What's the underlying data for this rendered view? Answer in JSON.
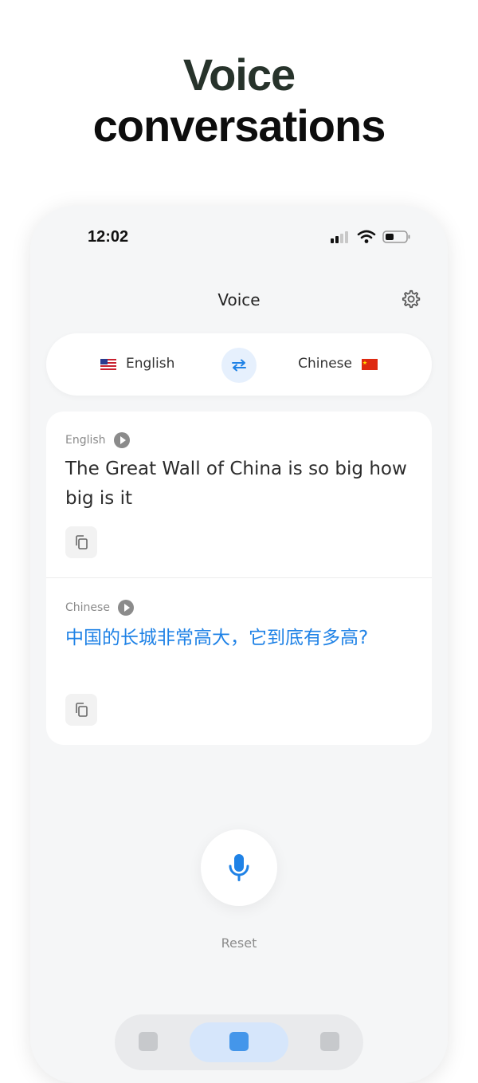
{
  "headline": {
    "line1": "Voice",
    "line2": "conversations"
  },
  "status_bar": {
    "time": "12:02"
  },
  "nav": {
    "title": "Voice",
    "settings_icon": "gear-icon"
  },
  "languages": {
    "source": {
      "label": "English",
      "flag": "us-flag"
    },
    "target": {
      "label": "Chinese",
      "flag": "china-flag"
    },
    "swap_icon": "swap-arrows-icon"
  },
  "translation": {
    "source": {
      "label": "English",
      "text": "The Great Wall of China is so big how big is it"
    },
    "target": {
      "label": "Chinese",
      "text": "中国的长城非常高大，它到底有多高?"
    }
  },
  "mic": {
    "icon": "microphone-icon"
  },
  "reset_label": "Reset",
  "colors": {
    "accent": "#1f82e6",
    "swap_bg": "#e6f0fd",
    "background": "#f5f6f7"
  }
}
